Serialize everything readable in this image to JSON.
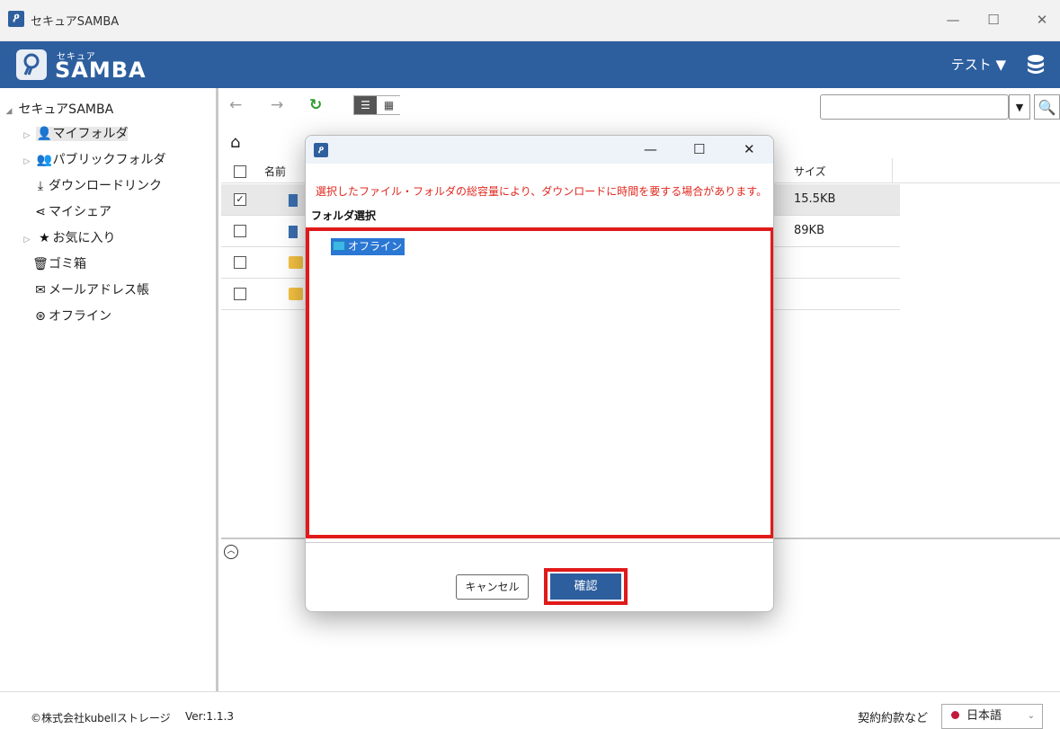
{
  "window": {
    "title": "セキュアSAMBA",
    "minimize": "—",
    "maximize": "☐",
    "close": "✕"
  },
  "header": {
    "logo_small": "セキュア",
    "logo_big": "SAMBA",
    "user_menu": "テスト ▼",
    "brand_color": "#2d5f9f"
  },
  "sidebar": {
    "root": "セキュアSAMBA",
    "items": [
      {
        "label": "マイフォルダ",
        "icon": "person-icon"
      },
      {
        "label": "パブリックフォルダ",
        "icon": "group-icon"
      },
      {
        "label": "ダウンロードリンク",
        "icon": "download-icon"
      },
      {
        "label": "マイシェア",
        "icon": "share-icon"
      },
      {
        "label": "お気に入り",
        "icon": "star-icon"
      },
      {
        "label": "ゴミ箱",
        "icon": "trash-icon"
      },
      {
        "label": "メールアドレス帳",
        "icon": "mail-icon"
      },
      {
        "label": "オフライン",
        "icon": "offline-icon"
      }
    ]
  },
  "toolbar": {
    "search_value": ""
  },
  "table": {
    "col_name": "名前",
    "col_size": "サイズ",
    "rows": [
      {
        "checked": true,
        "size": "15.5KB",
        "type": "file"
      },
      {
        "checked": false,
        "size": "89KB",
        "type": "file"
      },
      {
        "checked": false,
        "size": "",
        "type": "folder"
      },
      {
        "checked": false,
        "size": "",
        "type": "folder"
      }
    ]
  },
  "dialog": {
    "warning": "選択したファイル・フォルダの総容量により、ダウンロードに時間を要する場合があります。",
    "folder_label": "フォルダ選択",
    "tree_node": "オフライン",
    "cancel": "キャンセル",
    "confirm": "確認",
    "highlight_color": "#e01a1a"
  },
  "footer": {
    "copyright": "©株式会社kubellストレージ",
    "version": "Ver:1.1.3",
    "terms": "契約約款など",
    "language": "日本語"
  }
}
